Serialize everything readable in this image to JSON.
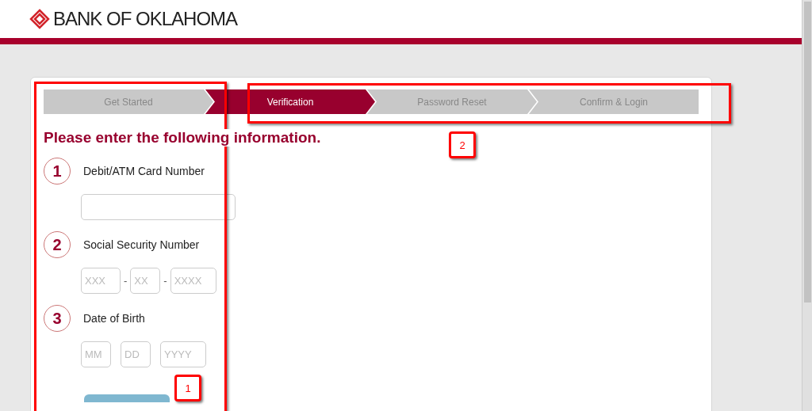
{
  "header": {
    "logo_text": "BANK OF OKLAHOMA"
  },
  "steps": [
    {
      "label": "Get Started",
      "selected": false
    },
    {
      "label": "Verification",
      "selected": true
    },
    {
      "label": "Password Reset",
      "selected": false
    },
    {
      "label": "Confirm & Login",
      "selected": false
    }
  ],
  "heading": "Please enter the following information.",
  "sections": [
    {
      "number": "1",
      "label": "Debit/ATM Card Number",
      "fields": [
        {
          "kind": "text"
        }
      ]
    },
    {
      "number": "2",
      "label": "Social Security Number",
      "fields": [
        {
          "kind": "text",
          "placeholder": "XXX"
        },
        {
          "kind": "text",
          "placeholder": "XX"
        },
        {
          "kind": "text",
          "placeholder": "XXXX"
        }
      ],
      "separator": "-"
    },
    {
      "number": "3",
      "label": "Date of Birth",
      "fields": [
        {
          "kind": "text",
          "placeholder": "MM"
        },
        {
          "kind": "text",
          "placeholder": "DD"
        },
        {
          "kind": "text",
          "placeholder": "YYYY"
        }
      ]
    }
  ],
  "callouts": [
    {
      "label": "1"
    },
    {
      "label": "2"
    }
  ]
}
